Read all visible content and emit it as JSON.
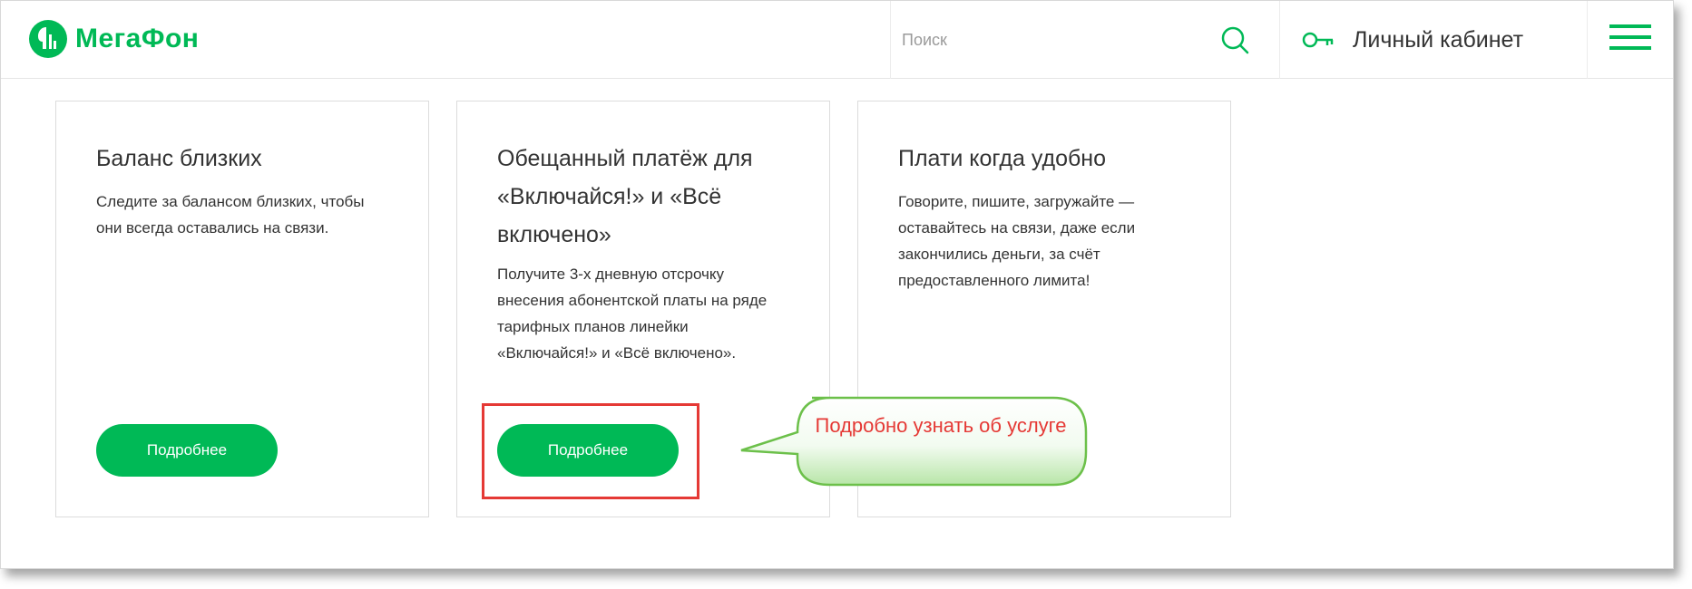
{
  "header": {
    "logo_text": "МегаФон",
    "search_placeholder": "Поиск",
    "account_label": "Личный кабинет"
  },
  "cards": [
    {
      "title": "Баланс близких",
      "description": "Следите за балансом близких, чтобы они всегда оставались на связи.",
      "button_label": "Подробнее"
    },
    {
      "title": "Обещанный платёж для «Включайся!» и «Всё включено»",
      "description": "Получите 3-х дневную отсрочку внесения абонентской платы на ряде тарифных планов линейки «Включайся!» и «Всё включено».",
      "button_label": "Подробнее"
    },
    {
      "title": "Плати когда удобно",
      "description": "Говорите, пишите, загружайте — оставайтесь на связи, даже если закончились деньги, за счёт предоставленного лимита!"
    }
  ],
  "annotation": {
    "callout_text": "Подробно узнать об услуге"
  },
  "icons": {
    "logo": "megafon-logo-icon",
    "search": "search-icon",
    "account": "key-icon",
    "menu": "hamburger-menu-icon"
  },
  "colors": {
    "brand_green": "#00b956",
    "annotation_red": "#e53935",
    "text": "#333333"
  }
}
